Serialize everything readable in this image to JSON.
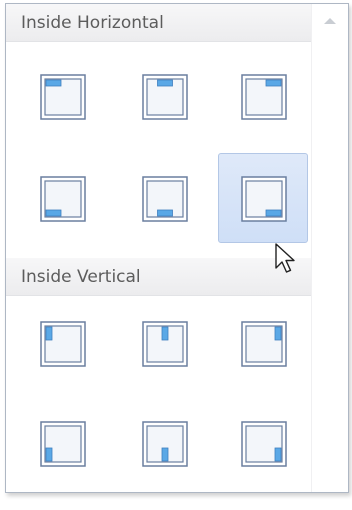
{
  "sections": [
    {
      "title": "Inside Horizontal",
      "items": [
        {
          "name": "inside-horizontal-top-left-icon",
          "kind": "h",
          "pos": "top-left"
        },
        {
          "name": "inside-horizontal-top-center-icon",
          "kind": "h",
          "pos": "top-center"
        },
        {
          "name": "inside-horizontal-top-right-icon",
          "kind": "h",
          "pos": "top-right"
        },
        {
          "name": "inside-horizontal-bottom-left-icon",
          "kind": "h",
          "pos": "bottom-left"
        },
        {
          "name": "inside-horizontal-bottom-center-icon",
          "kind": "h",
          "pos": "bottom-center"
        },
        {
          "name": "inside-horizontal-bottom-right-icon",
          "kind": "h",
          "pos": "bottom-right",
          "selected": true
        }
      ]
    },
    {
      "title": "Inside Vertical",
      "items": [
        {
          "name": "inside-vertical-top-left-icon",
          "kind": "v",
          "pos": "top-left"
        },
        {
          "name": "inside-vertical-top-center-icon",
          "kind": "v",
          "pos": "top-center"
        },
        {
          "name": "inside-vertical-top-right-icon",
          "kind": "v",
          "pos": "top-right"
        },
        {
          "name": "inside-vertical-bottom-left-icon",
          "kind": "v",
          "pos": "bottom-left"
        },
        {
          "name": "inside-vertical-bottom-center-icon",
          "kind": "v",
          "pos": "bottom-center"
        },
        {
          "name": "inside-vertical-bottom-right-icon",
          "kind": "v",
          "pos": "bottom-right"
        }
      ]
    }
  ],
  "colors": {
    "frame": "#6a7f9f",
    "frame_fill": "#f3f6fa",
    "marker": "#5aa8e6",
    "selection": "#cfdff7"
  }
}
